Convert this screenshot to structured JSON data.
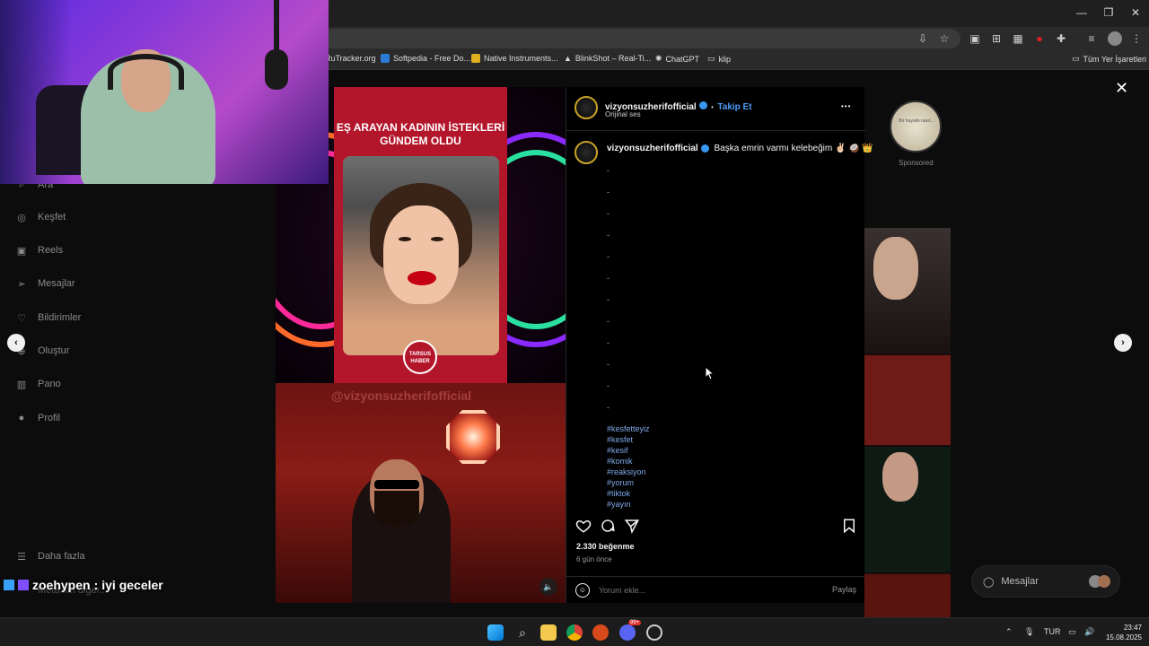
{
  "bookmarks": [
    {
      "label": "RuTracker.org",
      "color": "#3a6fd8"
    },
    {
      "label": "Softpedia - Free Do...",
      "color": "#2b7bd6"
    },
    {
      "label": "Native Instruments...",
      "color": "#e0b020"
    },
    {
      "label": "BlinkShot – Real-Ti...",
      "color": "#ffffff"
    },
    {
      "label": "ChatGPT",
      "color": "#cccccc"
    },
    {
      "label": "klip",
      "color": "#cccccc"
    }
  ],
  "all_bookmarks": "Tüm Yer İşaretleri",
  "sidebar": {
    "items": [
      {
        "label": "Ara",
        "icon": "search-icon"
      },
      {
        "label": "Keşfet",
        "icon": "compass-icon"
      },
      {
        "label": "Reels",
        "icon": "reels-icon"
      },
      {
        "label": "Mesajlar",
        "icon": "send-icon"
      },
      {
        "label": "Bildirimler",
        "icon": "heart-icon"
      },
      {
        "label": "Oluştur",
        "icon": "plus-icon"
      },
      {
        "label": "Pano",
        "icon": "chart-icon"
      },
      {
        "label": "Profil",
        "icon": "avatar-icon"
      }
    ],
    "more": "Daha fazla",
    "more_below": "Meta'nın diğer..."
  },
  "reel": {
    "card_title": "EŞ ARAYAN KADININ İSTEKLERİ GÜNDEM OLDU",
    "badge": "TARSUS HABER",
    "watermark": "@vizyonsuzherifofficial"
  },
  "post": {
    "username": "vizyonsuzherifofficial",
    "dot": "•",
    "follow": "Takip Et",
    "audio": "Orijinal ses",
    "more": "•••",
    "caption_user": "vizyonsuzherifofficial",
    "caption_text": "Başka emrin varmı kelebeğim ✌🏻 🥥 👑",
    "dashes": [
      "-",
      "-",
      "-",
      "-",
      "-",
      "-",
      "-",
      "-",
      "-",
      "-",
      "-",
      "-"
    ],
    "hashtags": [
      "#kesfetteyiz",
      "#kesfet",
      "#kesif",
      "#komik",
      "#reaksiyon",
      "#yorum",
      "#tiktok",
      "#yayın"
    ],
    "likes": "2.330 beğenme",
    "ago": "6 gün önce",
    "comment_placeholder": "Yorum ekle...",
    "share": "Paylaş"
  },
  "sponsored": "Sponsored",
  "sponsored_circle_text": "Bir hayalin nasıl...",
  "messages_pill": "Mesajlar",
  "chat": {
    "user": "zoehypen",
    "sep": ":",
    "text": "iyi geceler"
  },
  "taskbar": {
    "lang": "TUR",
    "time": "23:47",
    "date": "15.08.2025",
    "discord_badge": "99+"
  },
  "colors": {
    "accent": "#4f9cf9",
    "reel_red": "#b3162b"
  }
}
